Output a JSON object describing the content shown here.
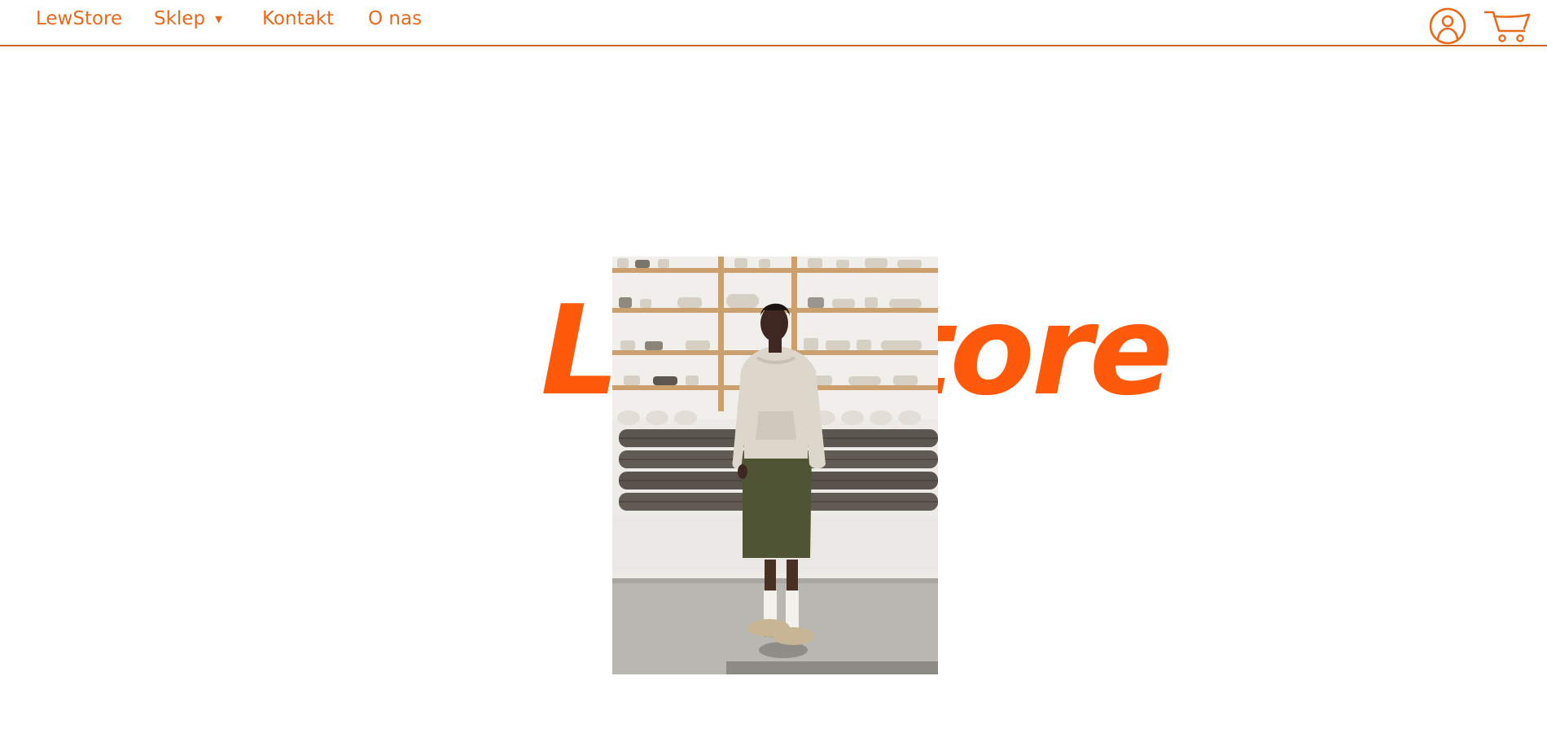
{
  "nav": {
    "brand": "LewStore",
    "shop": "Sklep",
    "shop_caret": "▾",
    "contact": "Kontakt",
    "about": "O nas"
  },
  "icons": {
    "account": "user-circle-icon",
    "cart": "shopping-cart-icon"
  },
  "hero": {
    "wordmark": "LewStore",
    "image_alt": "Model in hoodie and shorts standing in front of pottery shelves"
  },
  "colors": {
    "accent": "#ea6a1d",
    "wordmark": "#ff5a0c",
    "nav_border": "#c8661c",
    "background": "#ffffff"
  }
}
